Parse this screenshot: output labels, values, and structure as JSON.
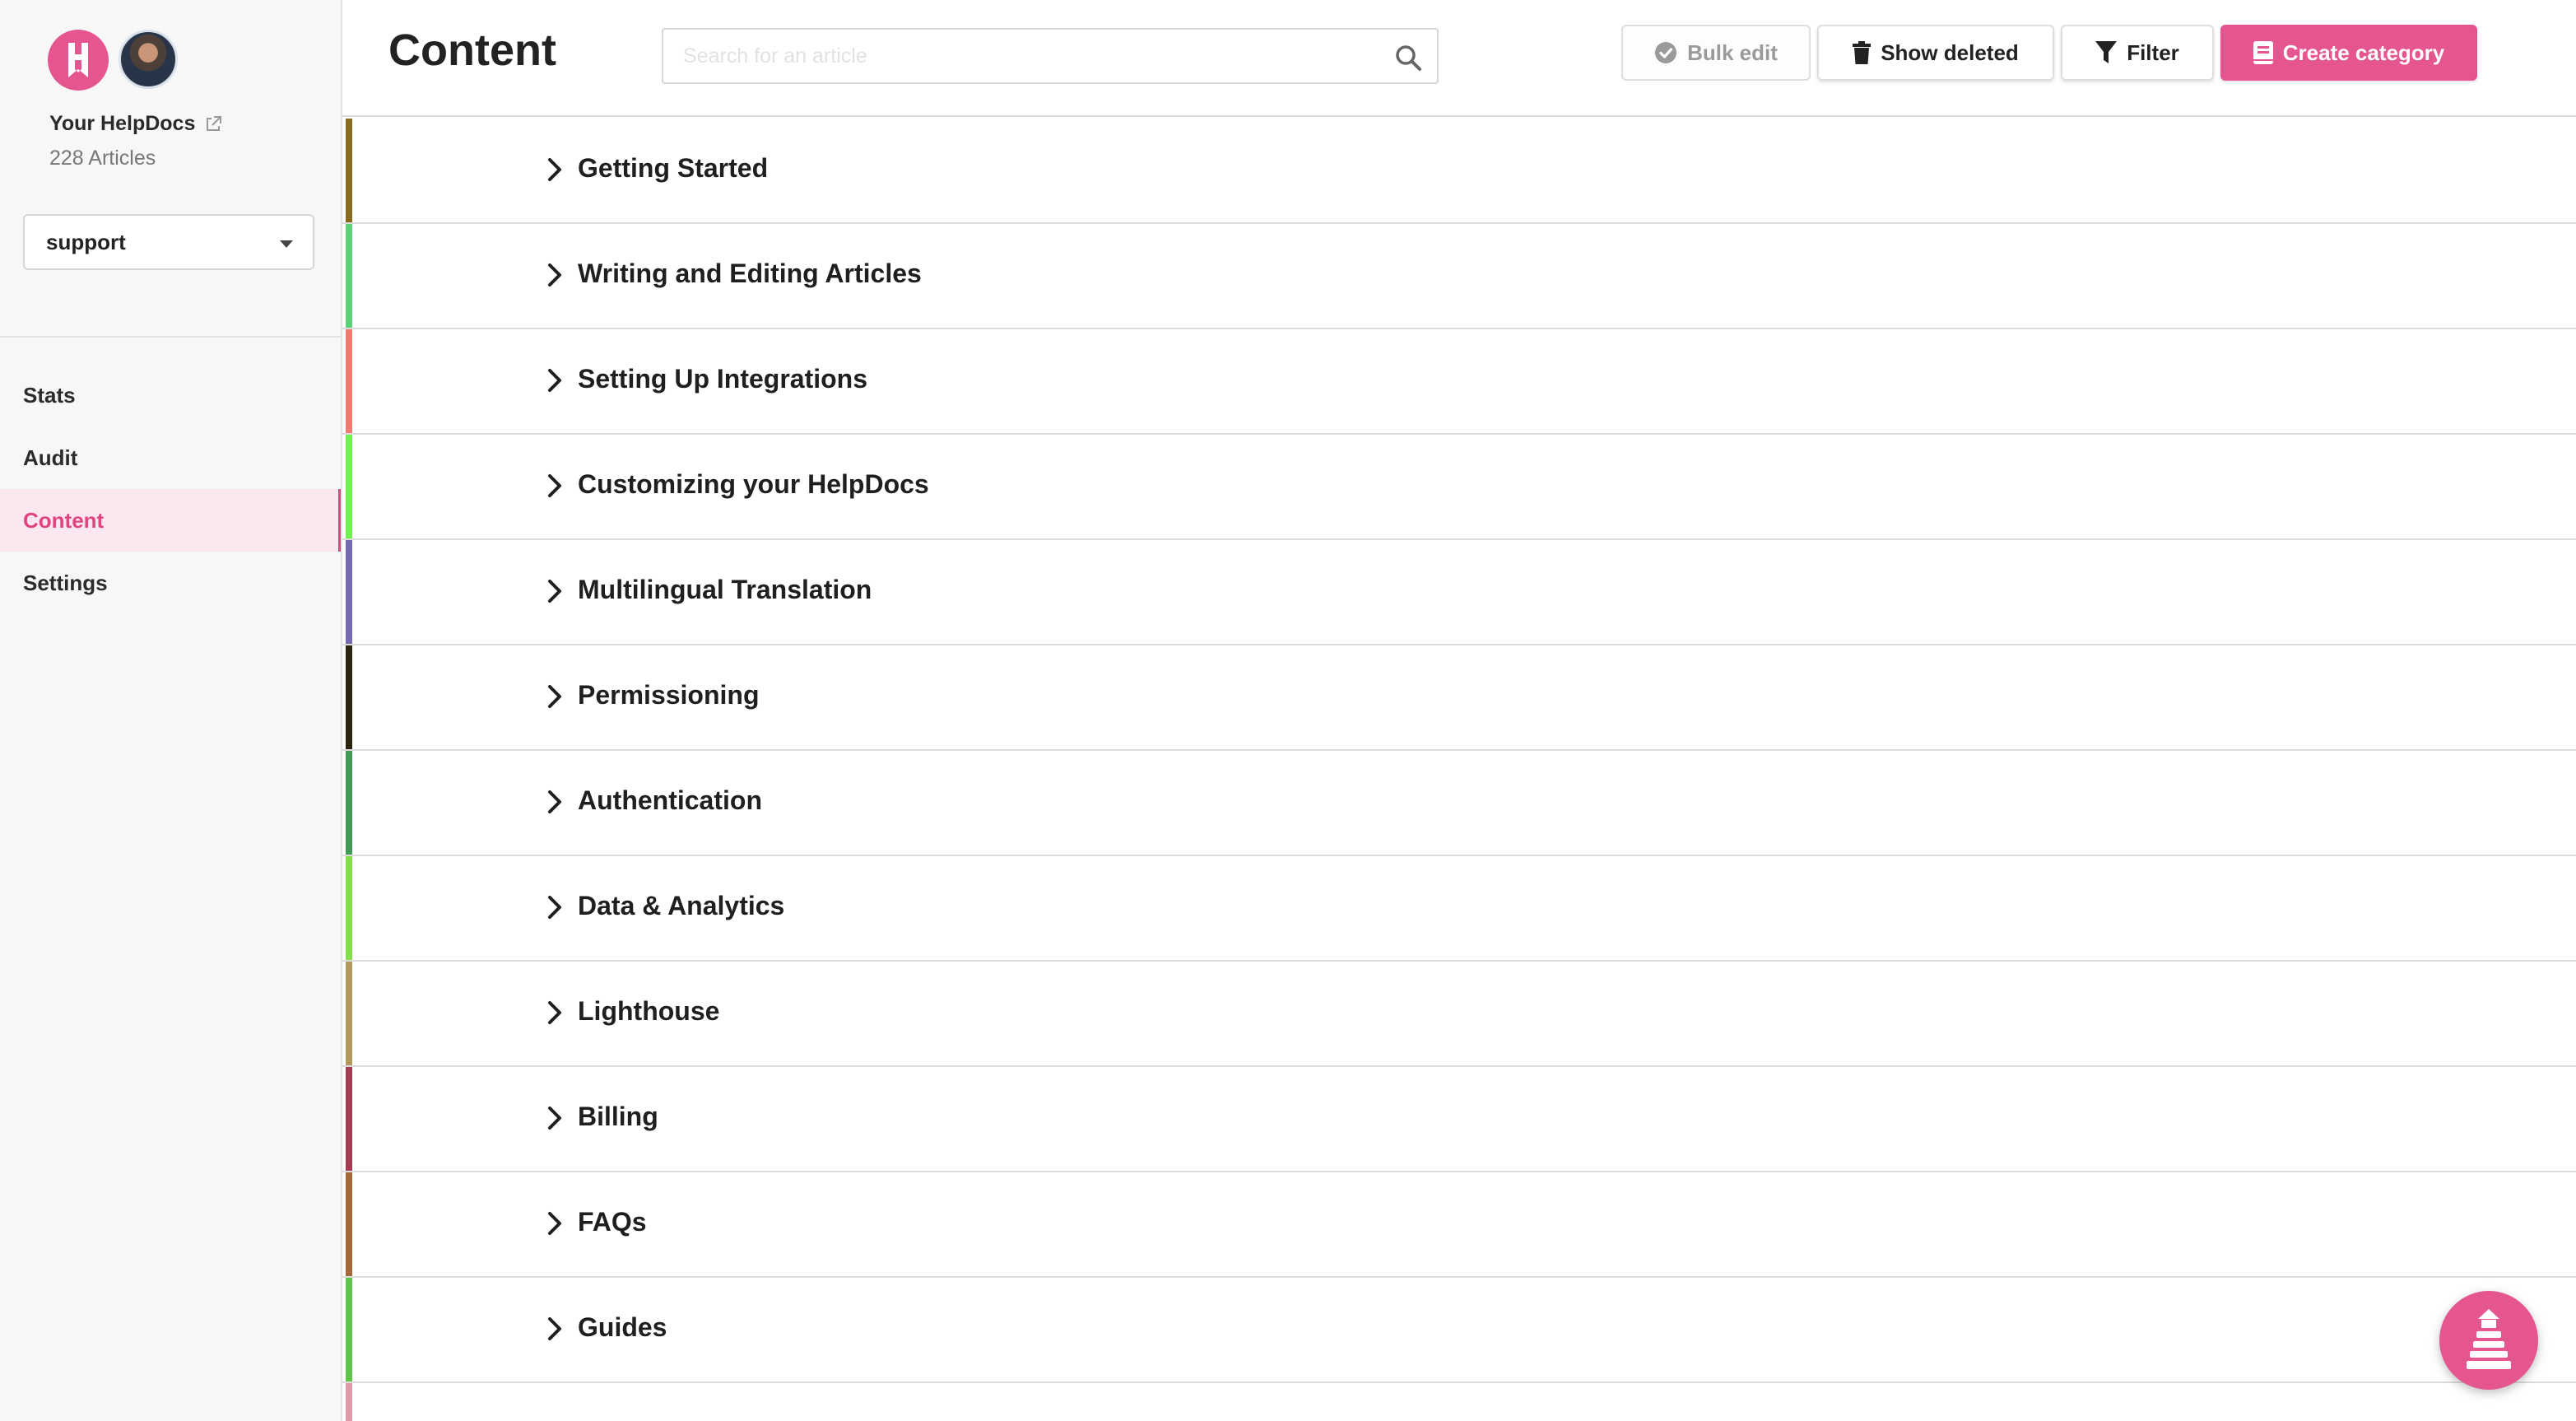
{
  "brand": {
    "name": "Your HelpDocs",
    "article_count": "228 Articles",
    "accent": "#e5558f"
  },
  "knowledge_base_select": {
    "value": "support"
  },
  "nav": {
    "items": [
      {
        "label": "Stats"
      },
      {
        "label": "Audit"
      },
      {
        "label": "Content"
      },
      {
        "label": "Settings"
      }
    ],
    "active": "Content"
  },
  "header": {
    "title": "Content",
    "search_placeholder": "Search for an article",
    "bulk_edit": "Bulk edit",
    "show_deleted": "Show deleted",
    "filter": "Filter",
    "create_category": "Create category"
  },
  "categories": [
    {
      "label": "Getting Started",
      "color": "#8a6a1e"
    },
    {
      "label": "Writing and Editing Articles",
      "color": "#5ccf78"
    },
    {
      "label": "Setting Up Integrations",
      "color": "#f07a72"
    },
    {
      "label": "Customizing your HelpDocs",
      "color": "#6df24e"
    },
    {
      "label": "Multilingual Translation",
      "color": "#7668b4"
    },
    {
      "label": "Permissioning",
      "color": "#2a2410"
    },
    {
      "label": "Authentication",
      "color": "#3f9a55"
    },
    {
      "label": "Data & Analytics",
      "color": "#7fe049"
    },
    {
      "label": "Lighthouse",
      "color": "#b49a5a"
    },
    {
      "label": "Billing",
      "color": "#a73b52"
    },
    {
      "label": "FAQs",
      "color": "#a7653a"
    },
    {
      "label": "Guides",
      "color": "#5fc44a"
    },
    {
      "label": "",
      "color": "#e09aa8"
    }
  ],
  "icons": {
    "logo": "helpdocs-logo-icon",
    "external": "external-link-icon",
    "search": "search-icon",
    "check": "check-circle-icon",
    "trash": "trash-icon",
    "filter": "filter-icon",
    "book": "book-icon",
    "chevron": "chevron-right-icon",
    "help": "lighthouse-icon"
  }
}
